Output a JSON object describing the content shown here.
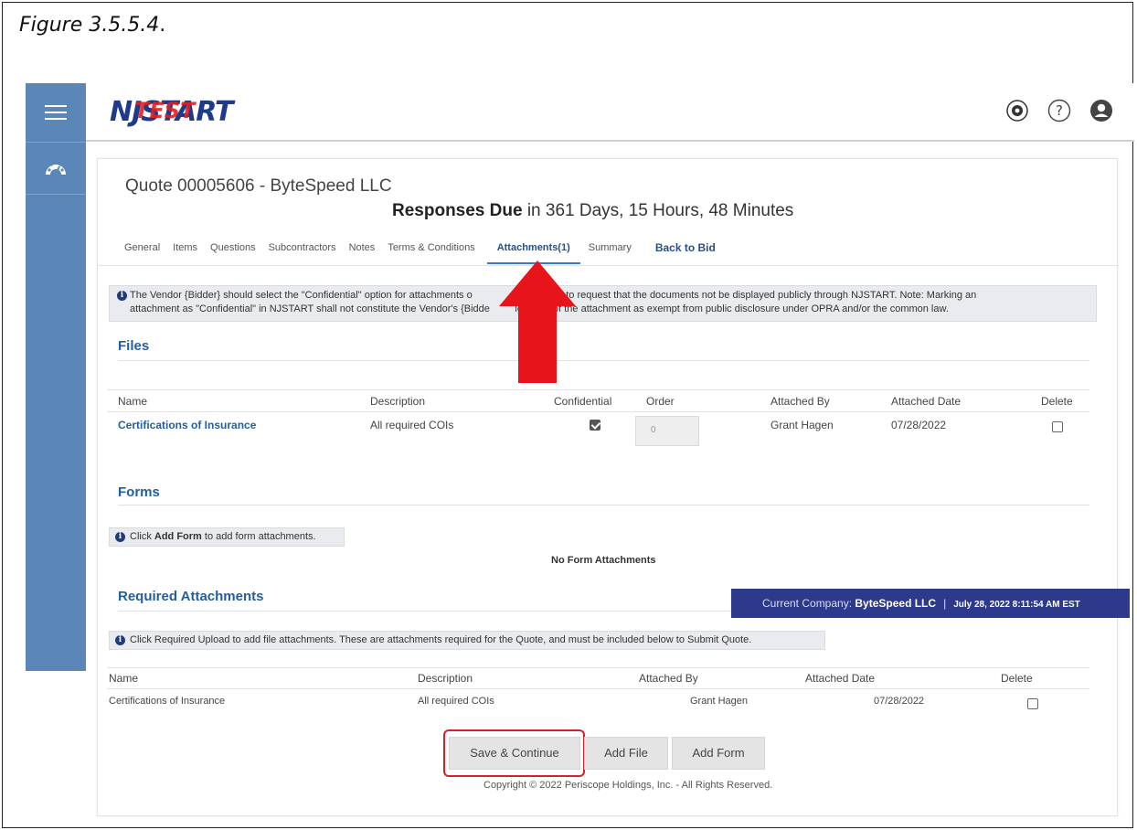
{
  "caption": {
    "text": "Figure 3.5.5.4",
    "punct": "."
  },
  "app": {
    "logo_text": "NJSTART",
    "logo_overlay": "TEST"
  },
  "header_icons": [
    "gear-icon",
    "help-icon",
    "user-icon"
  ],
  "quote": {
    "title": "Quote 00005606 - ByteSpeed LLC",
    "due_label": "Responses Due",
    "due_value": " in 361 Days, 15 Hours, 48 Minutes"
  },
  "tabs": [
    {
      "label": "General"
    },
    {
      "label": "Items"
    },
    {
      "label": "Questions"
    },
    {
      "label": "Subcontractors"
    },
    {
      "label": "Notes"
    },
    {
      "label": "Terms & Conditions"
    },
    {
      "label": "Attachments(1)",
      "active": true
    },
    {
      "label": "Summary"
    },
    {
      "label": "Back to Bid"
    }
  ],
  "notice": {
    "line1": "The Vendor {Bidder} should select the \"Confidential\" option for attachments o                ments Tab to request that the documents not be displayed publicly through NJSTART. Note: Marking an",
    "line2": "attachment as \"Confidential\" in NJSTART shall not constitute the Vendor's {Bidde         ignation of the attachment as exempt from public disclosure under OPRA and/or the common law."
  },
  "files": {
    "title": "Files",
    "columns": [
      "Name",
      "Description",
      "Confidential",
      "Order",
      "Attached By",
      "Attached Date",
      "Delete"
    ],
    "rows": [
      {
        "name": "Certifications of Insurance",
        "description": "All required COIs",
        "confidential": true,
        "order": "0",
        "attached_by": "Grant Hagen",
        "attached_date": "07/28/2022",
        "delete": false
      }
    ]
  },
  "forms": {
    "title": "Forms",
    "hint_pre": "Click ",
    "hint_bold": "Add Form",
    "hint_post": " to add form attachments.",
    "empty": "No Form Attachments"
  },
  "required": {
    "title": "Required Attachments",
    "hint": "Click Required Upload to add file attachments. These are attachments required for the Quote, and must be included below to Submit Quote.",
    "columns": [
      "Name",
      "Description",
      "Attached By",
      "Attached Date",
      "Delete"
    ],
    "rows": [
      {
        "name": "Certifications of Insurance",
        "description": "All required COIs",
        "attached_by": "Grant Hagen",
        "attached_date": "07/28/2022",
        "delete": false
      }
    ]
  },
  "company_bar": {
    "label": "Current Company: ",
    "company": "ByteSpeed LLC",
    "sep": "|",
    "datetime": "July 28, 2022 8:11:54 AM EST"
  },
  "buttons": {
    "save": "Save & Continue",
    "add_file": "Add File",
    "add_form": "Add Form"
  },
  "copyright": "Copyright © 2022 Periscope Holdings, Inc. - All Rights Reserved.",
  "colors": {
    "sidebar": "#5b86b8",
    "link": "#245e9c",
    "company_bar": "#2d3a8c",
    "annotation_red": "#e8141c"
  }
}
